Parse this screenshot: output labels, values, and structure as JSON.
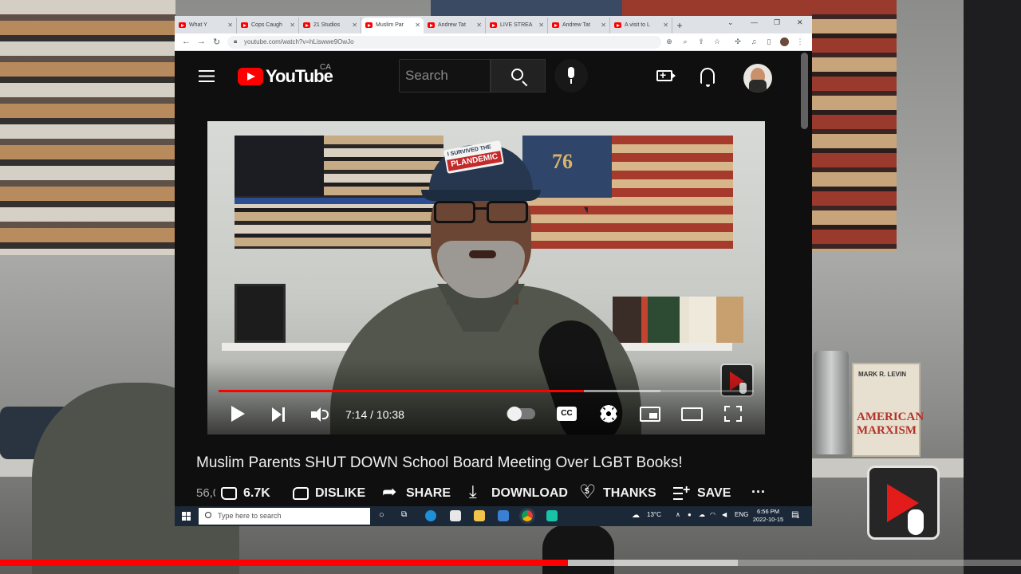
{
  "browser": {
    "tabs": [
      {
        "label": "What Y",
        "active": false
      },
      {
        "label": "Cops Caugh",
        "active": false
      },
      {
        "label": "21 Studios",
        "active": false
      },
      {
        "label": "Muslim Par",
        "active": true
      },
      {
        "label": "Andrew Tat",
        "active": false
      },
      {
        "label": "LIVE STREA",
        "active": false
      },
      {
        "label": "Andrew Tat",
        "active": false
      },
      {
        "label": "A visit to L",
        "active": false
      }
    ],
    "new_tab": "+",
    "url": "youtube.com/watch?v=hLiswwe9OwJo"
  },
  "youtube": {
    "logo_text": "YouTube",
    "country": "CA",
    "search_placeholder": "Search"
  },
  "player": {
    "time_display": "7:14 / 10:38",
    "progress_fraction": 0.683,
    "buffered_fraction": 0.826,
    "cc_label": "CC",
    "cap_line1": "I SURVIVED THE",
    "cap_line2": "PLANDEMIC",
    "flag_number": "76"
  },
  "video": {
    "title": "Muslim Parents SHUT DOWN School Board Meeting Over LGBT Books!",
    "views_partial": "56,0",
    "actions": {
      "like": "6.7K",
      "dislike": "DISLIKE",
      "share": "SHARE",
      "download": "DOWNLOAD",
      "thanks": "THANKS",
      "save": "SAVE",
      "more": "..."
    }
  },
  "taskbar": {
    "search_placeholder": "Type here to search",
    "weather": "13°C",
    "language": "ENG",
    "time": "6:56 PM",
    "date": "2022-10-15",
    "notifications": "1"
  },
  "background": {
    "book_author": "MARK R. LEVIN",
    "book_title": "AMERICAN MARXISM",
    "outer_progress_fraction": 0.556,
    "outer_buffered_fraction": 0.723
  },
  "colors": {
    "accent_red": "#ff0000",
    "yt_bg": "#0f0f0f",
    "taskbar": "#1b2838"
  }
}
